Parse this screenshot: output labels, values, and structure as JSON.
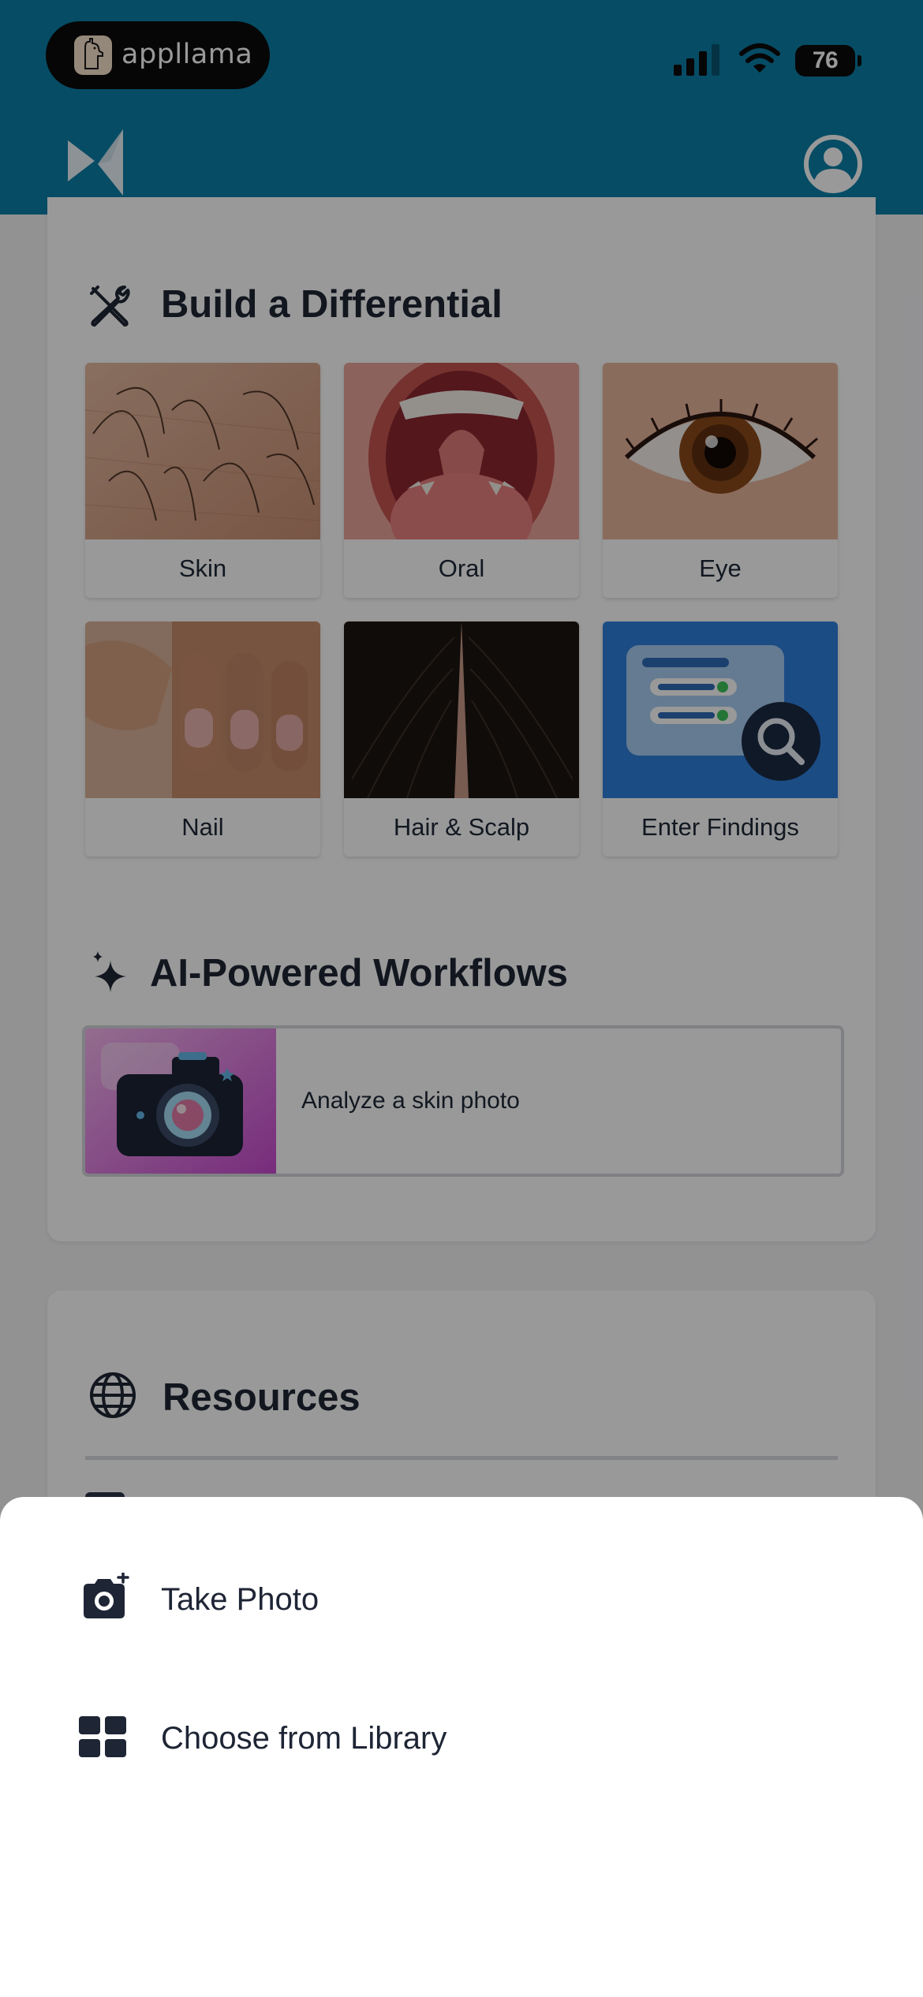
{
  "status_bar": {
    "badge_text": "appllama",
    "battery": "76"
  },
  "header": {
    "logo_icon": "bowtie-logo-icon",
    "profile_icon": "user-circle-icon"
  },
  "differential": {
    "title": "Build a Differential",
    "icon": "tools-icon",
    "tiles": [
      {
        "label": "Skin"
      },
      {
        "label": "Oral"
      },
      {
        "label": "Eye"
      },
      {
        "label": "Nail"
      },
      {
        "label": "Hair & Scalp"
      },
      {
        "label": "Enter Findings"
      }
    ]
  },
  "workflows": {
    "title": "AI-Powered Workflows",
    "icon": "sparkles-icon",
    "items": [
      {
        "label": "Analyze a skin photo"
      }
    ]
  },
  "resources": {
    "title": "Resources",
    "icon": "globe-icon"
  },
  "action_sheet": {
    "items": [
      {
        "label": "Take Photo",
        "icon": "camera-plus-icon"
      },
      {
        "label": "Choose from Library",
        "icon": "grid-icon"
      }
    ]
  },
  "colors": {
    "header": "#0a7fa8",
    "text_dark": "#1e2535",
    "scrim": "rgba(0,0,0,0.40)"
  }
}
